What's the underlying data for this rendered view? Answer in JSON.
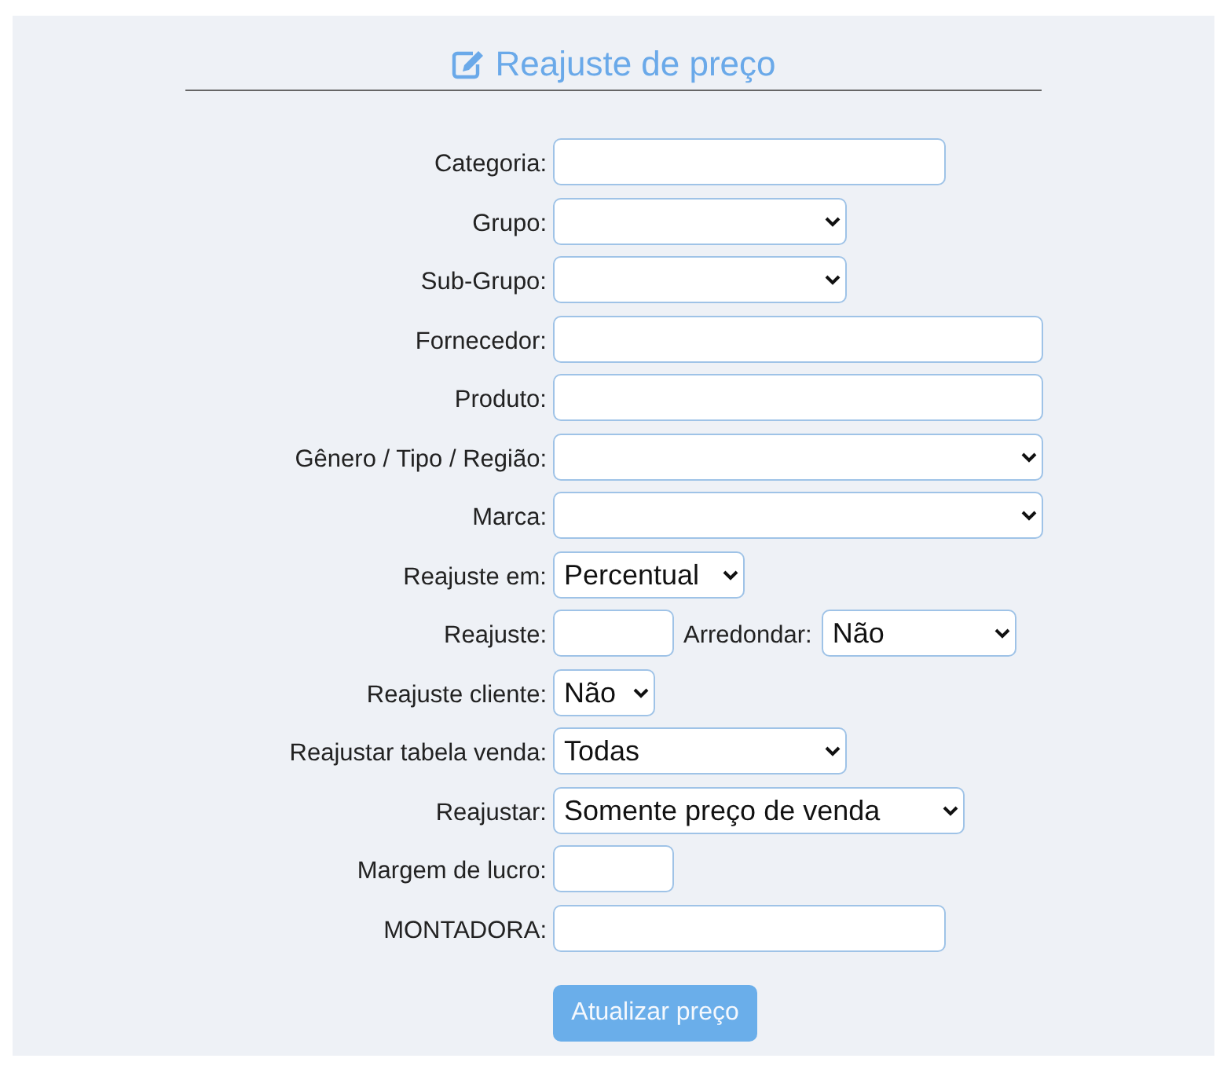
{
  "title": "Reajuste de preço",
  "fields": [
    {
      "label": "Categoria:",
      "kind": "text"
    },
    {
      "label": "Grupo:",
      "kind": "select"
    },
    {
      "label": "Sub-Grupo:",
      "kind": "select"
    },
    {
      "label": "Fornecedor:",
      "kind": "text"
    },
    {
      "label": "Produto:",
      "kind": "text"
    },
    {
      "label": "Gênero / Tipo / Região:",
      "kind": "select"
    },
    {
      "label": "Marca:",
      "kind": "select"
    },
    {
      "label": "Reajuste em:",
      "kind": "select",
      "value": "Percentual"
    },
    {
      "label": "Reajuste:",
      "kind": "text",
      "extra": {
        "label": "Arredondar:",
        "kind": "select",
        "value": "Não"
      }
    },
    {
      "label": "Reajuste cliente:",
      "kind": "select",
      "value": "Não"
    },
    {
      "label": "Reajustar tabela venda:",
      "kind": "select",
      "value": "Todas"
    },
    {
      "label": "Reajustar:",
      "kind": "select",
      "value": "Somente preço de venda"
    },
    {
      "label": "Margem de lucro:",
      "kind": "text"
    },
    {
      "label": "MONTADORA:",
      "kind": "text"
    }
  ],
  "button": "Atualizar preço"
}
